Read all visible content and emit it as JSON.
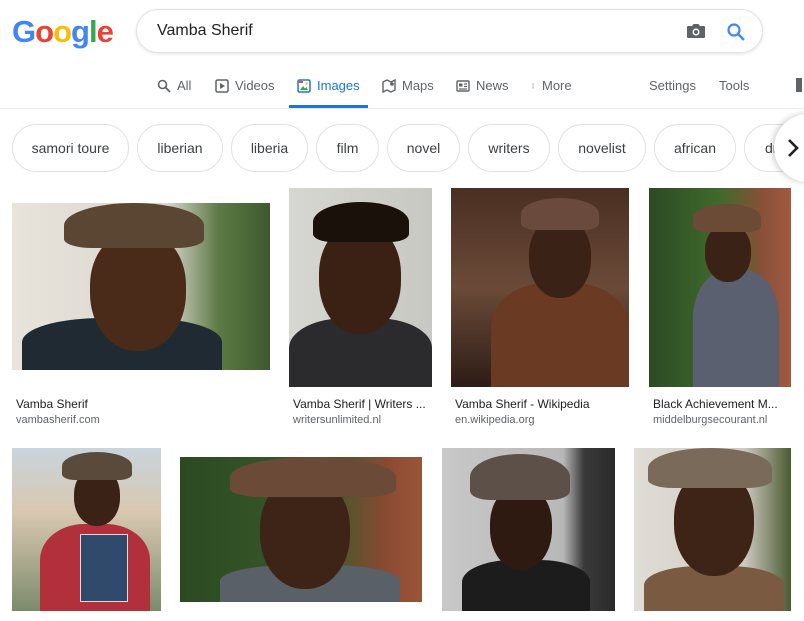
{
  "logo": {
    "letters": [
      "G",
      "o",
      "o",
      "g",
      "l",
      "e"
    ],
    "colors": [
      "#4285f4",
      "#ea4335",
      "#fbbc05",
      "#4285f4",
      "#34a853",
      "#ea4335"
    ]
  },
  "search": {
    "query": "Vamba Sherif"
  },
  "tabs": [
    {
      "label": "All",
      "icon": "search-icon",
      "active": false
    },
    {
      "label": "Videos",
      "icon": "play-icon",
      "active": false
    },
    {
      "label": "Images",
      "icon": "image-icon",
      "active": true
    },
    {
      "label": "Maps",
      "icon": "map-icon",
      "active": false
    },
    {
      "label": "News",
      "icon": "news-icon",
      "active": false
    },
    {
      "label": "More",
      "icon": "more-vert-icon",
      "active": false
    }
  ],
  "tools": {
    "settings": "Settings",
    "tools": "Tools"
  },
  "chips": [
    "samori toure",
    "liberian",
    "liberia",
    "film",
    "novel",
    "writers",
    "novelist",
    "african",
    "dr"
  ],
  "results": [
    {
      "title": "Vamba Sherif",
      "source": "vambasherif.com"
    },
    {
      "title": "Vamba Sherif | Writers ...",
      "source": "writersunlimited.nl"
    },
    {
      "title": "Vamba Sherif - Wikipedia",
      "source": "en.wikipedia.org"
    },
    {
      "title": "Black Achievement M...",
      "source": "middelburgsecourant.nl"
    },
    {
      "title": "",
      "source": ""
    },
    {
      "title": "",
      "source": ""
    },
    {
      "title": "",
      "source": ""
    },
    {
      "title": "",
      "source": ""
    }
  ],
  "colors": {
    "accent": "#1a73e8",
    "text_secondary": "#5f6368"
  }
}
